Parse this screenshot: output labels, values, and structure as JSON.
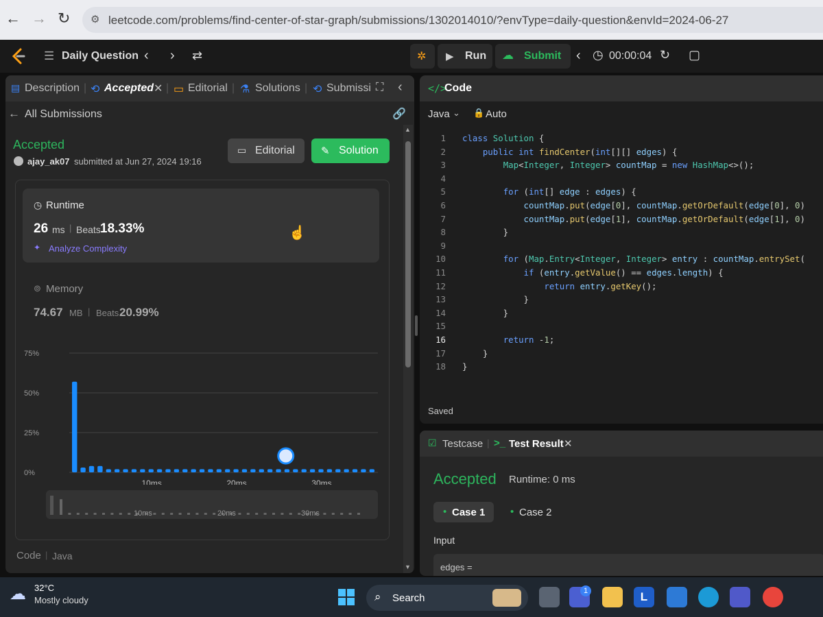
{
  "browser": {
    "url": "leetcode.com/problems/find-center-of-star-graph/submissions/1302014010/?envType=daily-question&envId=2024-06-27"
  },
  "topbar": {
    "title": "Daily Question",
    "run": "Run",
    "submit": "Submit",
    "timer": "00:00:04"
  },
  "left": {
    "tabs": [
      "Description",
      "Accepted",
      "Editorial",
      "Solutions",
      "Submissi"
    ],
    "back": "All Submissions",
    "status": "Accepted",
    "user": "ajay_ak07",
    "submitted": "submitted at Jun 27, 2024 19:16",
    "editorial_btn": "Editorial",
    "solution_btn": "Solution",
    "runtime": {
      "label": "Runtime",
      "value": "26",
      "unit": "ms",
      "beats_label": "Beats",
      "beats": "18.33%",
      "analyze": "Analyze Complexity"
    },
    "memory": {
      "label": "Memory",
      "value": "74.67",
      "unit": "MB",
      "beats_label": "Beats",
      "beats": "20.99%"
    },
    "footer_code": "Code",
    "footer_lang": "Java"
  },
  "chart_data": {
    "type": "bar",
    "y_ticks": [
      "75%",
      "50%",
      "25%",
      "0%"
    ],
    "ylim": [
      0,
      75
    ],
    "x_ticks": [
      "10ms",
      "20ms",
      "30ms"
    ],
    "x": [
      1,
      2,
      3,
      4,
      5,
      6,
      7,
      8,
      9,
      10,
      11,
      12,
      13,
      14,
      15,
      16,
      17,
      18,
      19,
      20,
      21,
      22,
      23,
      24,
      25,
      26,
      27,
      28,
      29,
      30,
      31,
      32,
      33,
      34,
      35,
      36
    ],
    "values": [
      57,
      3,
      4,
      4,
      2,
      2,
      2,
      2,
      2,
      2,
      2,
      2,
      2,
      2,
      2,
      2,
      2,
      2,
      2,
      2,
      2,
      2,
      2,
      2,
      2,
      2,
      2,
      2,
      2,
      2,
      2,
      2,
      2,
      2,
      2,
      2
    ],
    "highlight_x": 26,
    "colors": {
      "bar": "#1a8cff",
      "highlight": "#ffffff"
    }
  },
  "editor": {
    "header": "Code",
    "language": "Java",
    "mode": "Auto",
    "saved": "Saved",
    "line_numbers": [
      "1",
      "2",
      "3",
      "4",
      "5",
      "6",
      "7",
      "8",
      "9",
      "10",
      "11",
      "12",
      "13",
      "14",
      "15",
      "16",
      "17",
      "18"
    ],
    "lines": [
      "class Solution {",
      "    public int findCenter(int[][] edges) {",
      "        Map<Integer, Integer> countMap = new HashMap<>();",
      "",
      "        for (int[] edge : edges) {",
      "            countMap.put(edge[0], countMap.getOrDefault(edge[0], 0)",
      "            countMap.put(edge[1], countMap.getOrDefault(edge[1], 0)",
      "        }",
      "",
      "        for (Map.Entry<Integer, Integer> entry : countMap.entrySet(",
      "            if (entry.getValue() == edges.length) {",
      "                return entry.getKey();",
      "            }",
      "        }",
      "",
      "        return -1;",
      "    }",
      "}"
    ]
  },
  "result": {
    "tab_testcase": "Testcase",
    "tab_result": "Test Result",
    "status": "Accepted",
    "runtime": "Runtime: 0 ms",
    "case1": "Case 1",
    "case2": "Case 2",
    "input_label": "Input",
    "input_value": "edges ="
  },
  "taskbar": {
    "weather_temp": "32°C",
    "weather_desc": "Mostly cloudy",
    "search": "Search",
    "badge": "1"
  },
  "colors": {
    "accent_green": "#2cbb5d",
    "accepted_green": "#2db55d",
    "orange": "#ffa116"
  }
}
